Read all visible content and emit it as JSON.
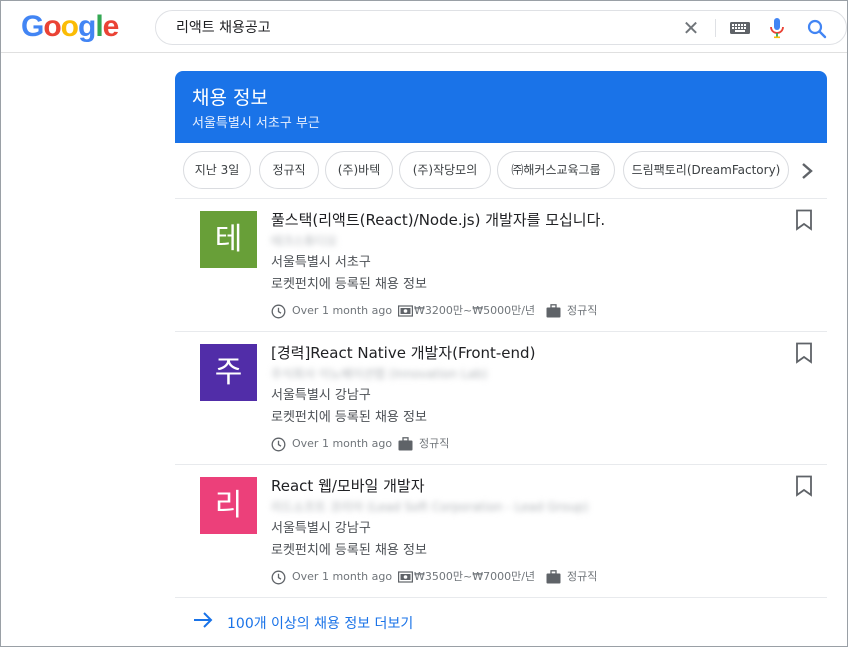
{
  "logo": {
    "letters": [
      "G",
      "o",
      "o",
      "g",
      "l",
      "e"
    ],
    "colors": [
      "#4285f4",
      "#ea4335",
      "#fbbc05",
      "#4285f4",
      "#34a853",
      "#ea4335"
    ]
  },
  "search": {
    "query": "리액트 채용공고",
    "clear_icon": "close-icon",
    "keyboard_icon": "keyboard-icon",
    "mic_icon": "mic-icon",
    "search_icon": "search-icon"
  },
  "banner": {
    "title": "채용 정보",
    "subtitle": "서울특별시 서초구 부근",
    "color": "#1a73e8"
  },
  "chips": [
    {
      "label": "지난 3일"
    },
    {
      "label": "정규직"
    },
    {
      "label": "(주)바텍"
    },
    {
      "label": "(주)작당모의"
    },
    {
      "label": "㈜해커스교육그룹"
    },
    {
      "label": "드림팩토리(DreamFactory)"
    }
  ],
  "jobs": [
    {
      "avatar_letter": "테",
      "avatar_color": "#689f38",
      "title": "풀스택(리액트(React)/Node.js) 개발자를 모십니다.",
      "company": "테크스튜디오",
      "location": "서울특별시 서초구",
      "via": "로켓펀치에 등록된 채용 정보",
      "posted": "Over 1 month ago",
      "salary": "₩3200만~₩5000만/년",
      "type": "정규직"
    },
    {
      "avatar_letter": "주",
      "avatar_color": "#512da8",
      "title": "[경력]React Native 개발자(Front-end)",
      "company": "주식회사 이노베이션랩 (Innovation Lab)",
      "location": "서울특별시 강남구",
      "via": "로켓펀치에 등록된 채용 정보",
      "posted": "Over 1 month ago",
      "salary": "",
      "type": "정규직"
    },
    {
      "avatar_letter": "리",
      "avatar_color": "#ec407a",
      "title": "React 웹/모바일 개발자",
      "company": "리드소프트 코리아 (Lead Soft Corporation - Lead Group)",
      "location": "서울특별시 강남구",
      "via": "로켓펀치에 등록된 채용 정보",
      "posted": "Over 1 month ago",
      "salary": "₩3500만~₩7000만/년",
      "type": "정규직"
    }
  ],
  "more": {
    "label": "100개 이상의 채용 정보 더보기"
  }
}
